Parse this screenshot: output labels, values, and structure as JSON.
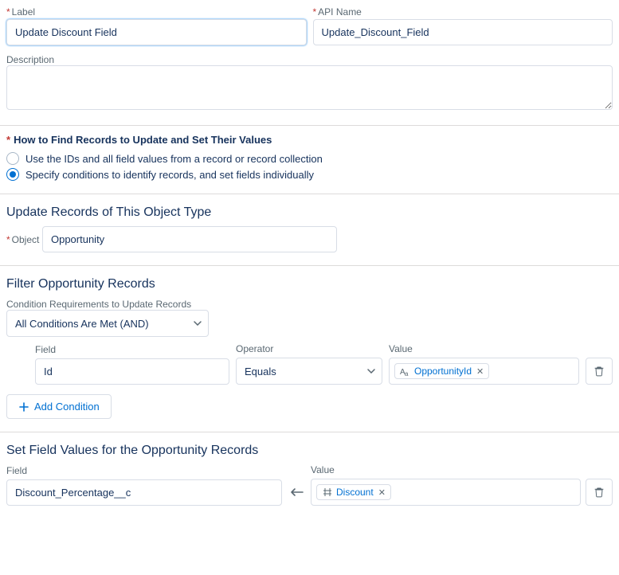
{
  "header": {
    "label_label": "Label",
    "label_value": "Update Discount Field",
    "apiname_label": "API Name",
    "apiname_value": "Update_Discount_Field",
    "description_label": "Description",
    "description_value": ""
  },
  "find": {
    "heading": "How to Find Records to Update and Set Their Values",
    "option1": "Use the IDs and all field values from a record or record collection",
    "option2": "Specify conditions to identify records, and set fields individually"
  },
  "objtype": {
    "heading": "Update Records of This Object Type",
    "object_label": "Object",
    "object_value": "Opportunity"
  },
  "filter": {
    "heading": "Filter Opportunity Records",
    "cond_req_label": "Condition Requirements to Update Records",
    "cond_req_value": "All Conditions Are Met (AND)",
    "col_field": "Field",
    "col_operator": "Operator",
    "col_value": "Value",
    "row": {
      "field": "Id",
      "operator": "Equals",
      "value_token": "OpportunityId"
    },
    "add_condition": "Add Condition"
  },
  "setvals": {
    "heading": "Set Field Values for the Opportunity Records",
    "col_field": "Field",
    "col_value": "Value",
    "row": {
      "field": "Discount_Percentage__c",
      "value_token": "Discount"
    }
  }
}
